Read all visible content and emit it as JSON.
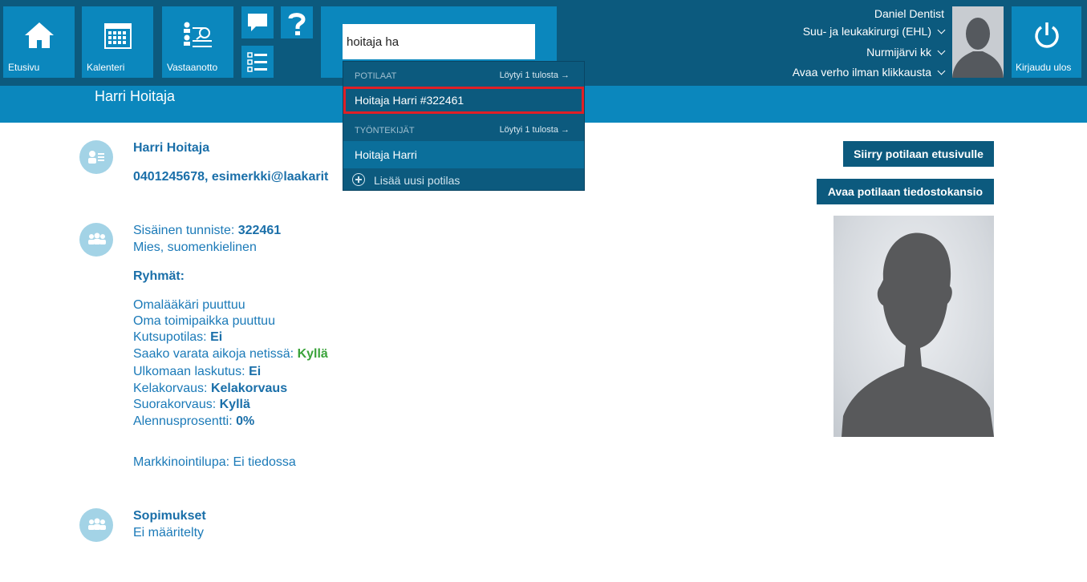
{
  "nav": {
    "home_label": "Etusivu",
    "calendar_label": "Kalenteri",
    "reception_label": "Vastaanotto",
    "logout_label": "Kirjaudu ulos"
  },
  "search": {
    "value": "hoitaja ha",
    "placeholder": ""
  },
  "user": {
    "name": "Daniel Dentist",
    "role": "Suu- ja leukakirurgi (EHL)",
    "location": "Nurmijärvi kk",
    "curtain": "Avaa verho ilman klikkausta"
  },
  "dropdown": {
    "patients_header": "POTILAAT",
    "patients_found": "Löytyi 1 tulosta →",
    "patient_result": "Hoitaja Harri #322461",
    "employees_header": "TYÖNTEKIJÄT",
    "employees_found": "Löytyi 1 tulosta →",
    "employee_result": "Hoitaja Harri",
    "add_patient": "Lisää uusi potilas"
  },
  "patient": {
    "header_name": "Harri Hoitaja",
    "name": "Harri Hoitaja",
    "contact": "0401245678, esimerkki@laakarit",
    "internal_id_label": "Sisäinen tunniste: ",
    "internal_id": "322461",
    "gender_language": "Mies, suomenkielinen",
    "groups_title": "Ryhmät:",
    "no_gp": "Omalääkäri puuttuu",
    "no_office": "Oma toimipaikka puuttuu",
    "invite_label": "Kutsupotilas: ",
    "invite_value": "Ei",
    "online_booking_label": "Saako varata aikoja netissä: ",
    "online_booking_value": "Kyllä",
    "foreign_billing_label": "Ulkomaan laskutus: ",
    "foreign_billing_value": "Ei",
    "kela_label": "Kelakorvaus: ",
    "kela_value": "Kelakorvaus",
    "direct_label": "Suorakorvaus: ",
    "direct_value": "Kyllä",
    "discount_label": "Alennusprosentti: ",
    "discount_value": "0%",
    "marketing": "Markkinointilupa: Ei tiedossa",
    "contracts_title": "Sopimukset",
    "contracts_value": "Ei määritelty"
  },
  "actions": {
    "goto_front": "Siirry potilaan etusivulle",
    "open_folder": "Avaa potilaan tiedostokansio"
  },
  "colors": {
    "topbar": "#0c5a7e",
    "tile": "#0b87bd",
    "highlight": "#e01f26",
    "text_link": "#1b7ab8",
    "yes_green": "#3aa33a"
  }
}
